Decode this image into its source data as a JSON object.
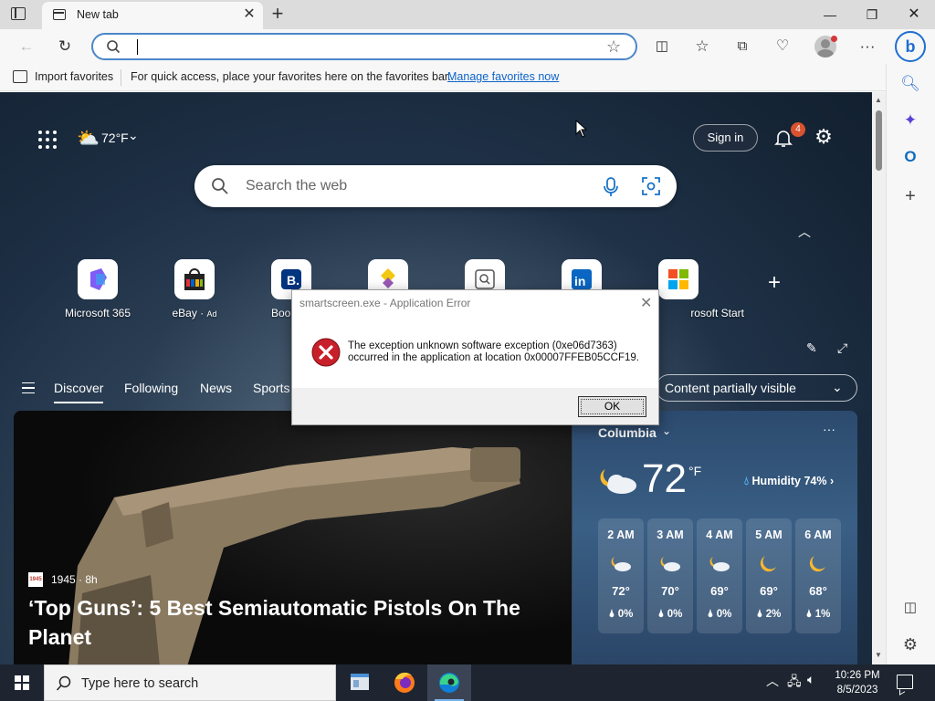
{
  "browser": {
    "tab": {
      "title": "New tab",
      "icon": "newtab-icon"
    },
    "address": {
      "value": "",
      "placeholder": ""
    },
    "favorites_bar": {
      "import_label": "Import favorites",
      "message": "For quick access, place your favorites here on the favorites bar.",
      "link": "Manage favorites now"
    },
    "accent": "#4b87c9"
  },
  "newtab": {
    "weather": {
      "temp": "72°F"
    },
    "sign_in": "Sign in",
    "notifications_count": "4",
    "search_placeholder": "Search the web",
    "quick_links": [
      {
        "label": "Microsoft 365",
        "ad": ""
      },
      {
        "label": "eBay",
        "ad": "Ad"
      },
      {
        "label": "Booking",
        "ad": ""
      },
      {
        "label": "",
        "ad": ""
      },
      {
        "label": "",
        "ad": ""
      },
      {
        "label": "",
        "ad": ""
      },
      {
        "label": "rosoft Start",
        "ad": ""
      }
    ],
    "feed_tabs": [
      "Discover",
      "Following",
      "News",
      "Sports"
    ],
    "content_visibility": "Content partially visible",
    "hero": {
      "source": "1945 · 8h",
      "source_logo": "1945",
      "title": "‘Top Guns’: 5 Best Semiautomatic Pistols On The Planet"
    },
    "weather_card": {
      "location": "Columbia",
      "temp": "72",
      "unit": "°F",
      "humidity": "Humidity 74%",
      "hourly": [
        {
          "time": "2 AM",
          "temp": "72°",
          "precip": "0%",
          "icon": "partly-cloudy-night"
        },
        {
          "time": "3 AM",
          "temp": "70°",
          "precip": "0%",
          "icon": "partly-cloudy-night"
        },
        {
          "time": "4 AM",
          "temp": "69°",
          "precip": "0%",
          "icon": "partly-cloudy-night"
        },
        {
          "time": "5 AM",
          "temp": "69°",
          "precip": "2%",
          "icon": "clear-night"
        },
        {
          "time": "6 AM",
          "temp": "68°",
          "precip": "1%",
          "icon": "clear-night"
        }
      ]
    }
  },
  "dialog": {
    "title": "smartscreen.exe - Application Error",
    "message_line1": "The exception unknown software exception (0xe06d7363)",
    "message_line2": "occurred in the application at location 0x00007FFEB05CCF19.",
    "ok_label": "OK"
  },
  "taskbar": {
    "search_placeholder": "Type here to search",
    "time": "10:26 PM",
    "date": "8/5/2023"
  }
}
